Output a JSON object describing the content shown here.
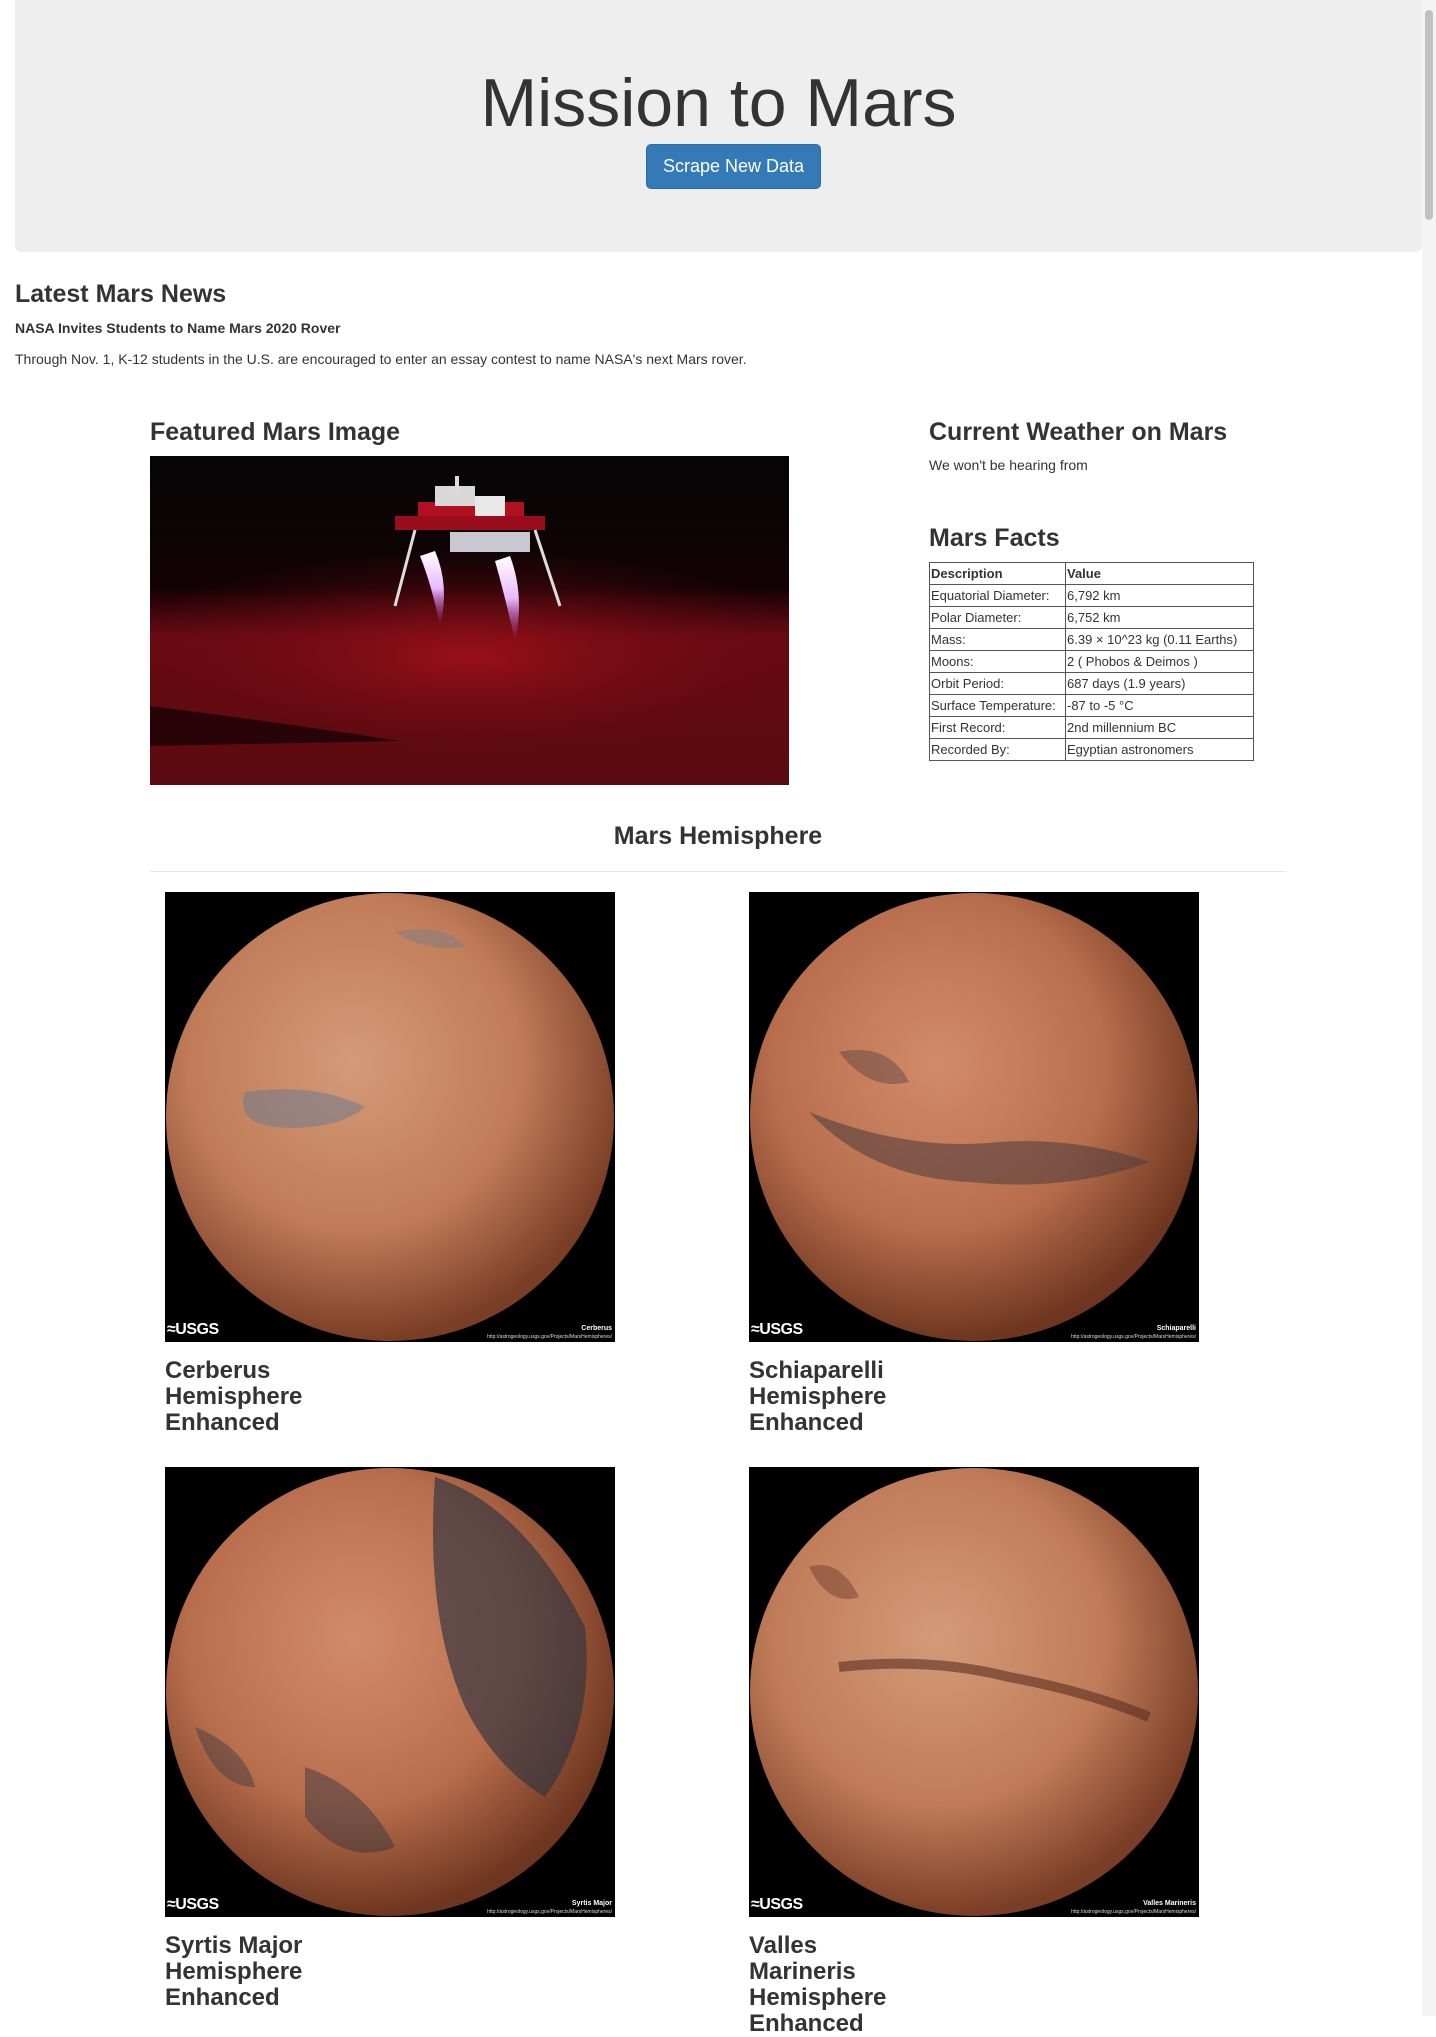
{
  "header": {
    "title": "Mission to Mars",
    "scrape_button": "Scrape New Data"
  },
  "news": {
    "section_title": "Latest Mars News",
    "headline": "NASA Invites Students to Name Mars 2020 Rover",
    "teaser": "Through Nov. 1, K-12 students in the U.S. are encouraged to enter an essay contest to name NASA's next Mars rover."
  },
  "featured": {
    "section_title": "Featured Mars Image",
    "image_alt": "Mars lander descending"
  },
  "weather": {
    "section_title": "Current Weather on Mars",
    "text": "We won't be hearing from"
  },
  "facts": {
    "section_title": "Mars Facts",
    "headers": [
      "Description",
      "Value"
    ],
    "rows": [
      [
        "Equatorial Diameter:",
        "6,792 km"
      ],
      [
        "Polar Diameter:",
        "6,752 km"
      ],
      [
        "Mass:",
        "6.39 × 10^23 kg (0.11 Earths)"
      ],
      [
        "Moons:",
        "2 ( Phobos & Deimos )"
      ],
      [
        "Orbit Period:",
        "687 days (1.9 years)"
      ],
      [
        "Surface Temperature:",
        "-87 to -5 °C"
      ],
      [
        "First Record:",
        "2nd millennium BC"
      ],
      [
        "Recorded By:",
        "Egyptian astronomers"
      ]
    ]
  },
  "hemispheres": {
    "section_title": "Mars Hemisphere",
    "items": [
      {
        "title": "Cerberus Hemisphere Enhanced",
        "image_label": "Cerberus",
        "usgs": "≈USGS",
        "url_text": "http://astrogeology.usgs.gov/Projects/MarsHemispheres/"
      },
      {
        "title": "Schiaparelli Hemisphere Enhanced",
        "image_label": "Schiaparelli",
        "usgs": "≈USGS",
        "url_text": "http://astrogeology.usgs.gov/Projects/MarsHemispheres/"
      },
      {
        "title": "Syrtis Major Hemisphere Enhanced",
        "image_label": "Syrtis Major",
        "usgs": "≈USGS",
        "url_text": "http://astrogeology.usgs.gov/Projects/MarsHemispheres/"
      },
      {
        "title": "Valles Marineris Hemisphere Enhanced",
        "image_label": "Valles Marineris",
        "usgs": "≈USGS",
        "url_text": "http://astrogeology.usgs.gov/Projects/MarsHemispheres/"
      }
    ]
  },
  "colors": {
    "accent": "#337ab7",
    "jumbotron_bg": "#eeeeee",
    "text": "#333333"
  }
}
